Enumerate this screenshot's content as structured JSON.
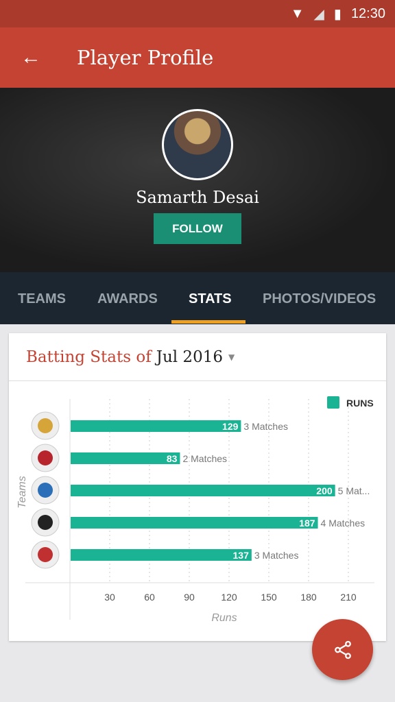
{
  "status": {
    "time": "12:30",
    "icons": [
      "wifi-icon",
      "signal-icon",
      "battery-icon"
    ]
  },
  "appbar": {
    "title": "Player Profile",
    "back_icon": "arrow-left-icon"
  },
  "profile": {
    "name": "Samarth Desai",
    "follow_label": "FOLLOW"
  },
  "tabs": [
    {
      "label": "TEAMS"
    },
    {
      "label": "AWARDS"
    },
    {
      "label": "STATS",
      "active": true
    },
    {
      "label": "PHOTOS/VIDEOS"
    }
  ],
  "card": {
    "title_prefix": "Batting Stats of",
    "month": "Jul 2016"
  },
  "colors": {
    "primary": "#c44333",
    "bar": "#1ab394",
    "accent": "#f0a020"
  },
  "chart_data": {
    "type": "bar",
    "orientation": "horizontal",
    "xlabel": "Runs",
    "ylabel": "Teams",
    "legend": {
      "label": "RUNS",
      "position": "top-right"
    },
    "ticks": [
      30,
      60,
      90,
      120,
      150,
      180,
      210
    ],
    "xlim": [
      0,
      225
    ],
    "grid": true,
    "values": [
      129,
      83,
      200,
      187,
      137
    ],
    "annotations": [
      "3 Matches",
      "2 Matches",
      "5 Mat...",
      "4 Matches",
      "3 Matches"
    ],
    "category_icons": [
      "team-logo-1",
      "team-logo-2",
      "team-logo-3",
      "team-logo-4",
      "team-logo-5"
    ]
  },
  "fab": {
    "icon": "share-icon"
  }
}
